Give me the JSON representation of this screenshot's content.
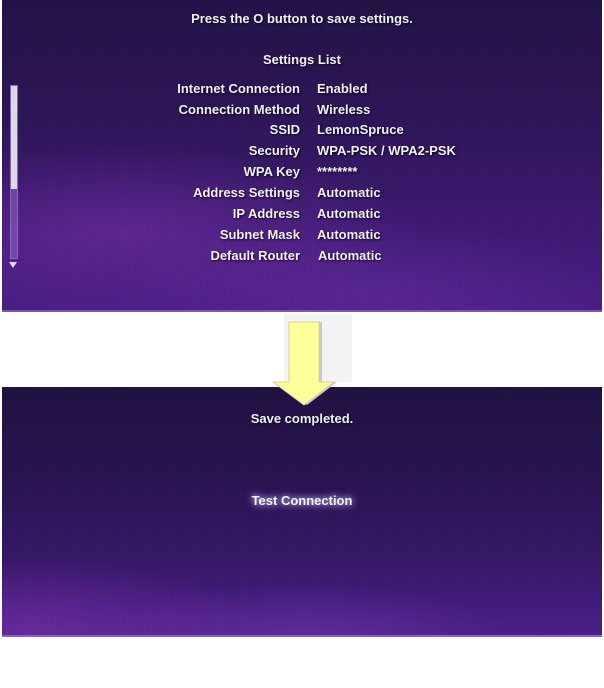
{
  "top_screen": {
    "instruction": "Press the O button to save settings.",
    "list_title": "Settings List",
    "settings": [
      {
        "label": "Internet Connection",
        "value": "Enabled"
      },
      {
        "label": "Connection Method",
        "value": "Wireless"
      },
      {
        "label": "SSID",
        "value": "LemonSpruce"
      },
      {
        "label": "Security",
        "value": "WPA-PSK / WPA2-PSK"
      },
      {
        "label": "WPA Key",
        "value": "********"
      },
      {
        "label": "Address Settings",
        "value": "Automatic"
      },
      {
        "label": "IP Address",
        "value": "Automatic"
      },
      {
        "label": "Subnet Mask",
        "value": "Automatic"
      },
      {
        "label": "Default Router",
        "value": "Automatic"
      }
    ],
    "scrollbar": {
      "visible_fraction": 0.6,
      "position": 0.0
    }
  },
  "transition_arrow": {
    "icon": "down-arrow-icon",
    "color": "#ffff99"
  },
  "bottom_screen": {
    "status": "Save completed.",
    "test_connection_label": "Test Connection"
  }
}
